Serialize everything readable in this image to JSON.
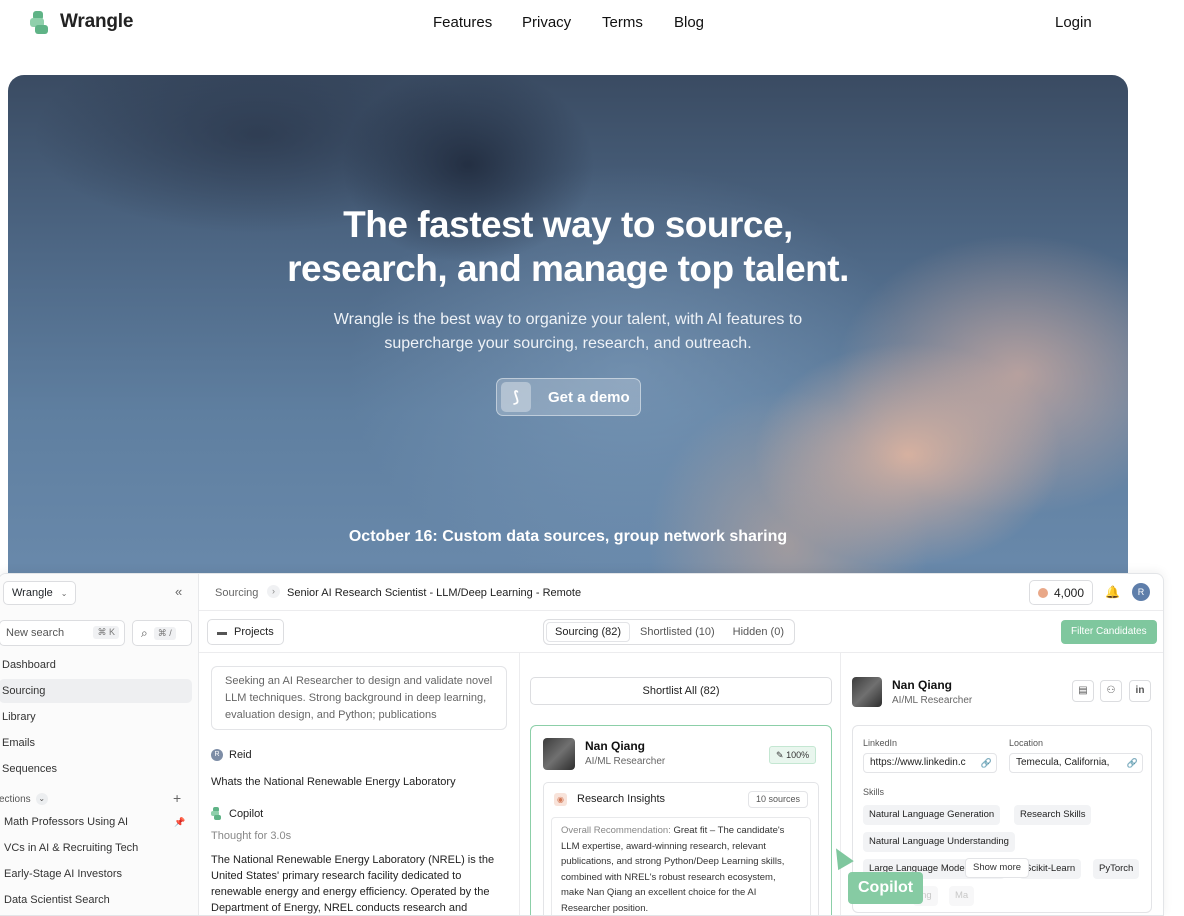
{
  "brand": {
    "name": "Wrangle",
    "accent": "#5fb386"
  },
  "nav": {
    "links": [
      "Features",
      "Privacy",
      "Terms",
      "Blog"
    ],
    "login": "Login"
  },
  "hero": {
    "title_line1": "The fastest way to source,",
    "title_line2": "research, and manage top talent.",
    "subtitle_line1": "Wrangle is the best way to organize your talent, with AI features to",
    "subtitle_line2": "supercharge your sourcing, research, and outreach.",
    "cta": "Get a demo",
    "news": "October 16: Custom data sources, group network sharing"
  },
  "app": {
    "workspace": "Wrangle",
    "search_placeholder": "New search",
    "search_shortcut": "⌘ K",
    "command_shortcut": "⌘ /",
    "sidebar_items": [
      "Dashboard",
      "Sourcing",
      "Library",
      "Emails",
      "Sequences"
    ],
    "active_item": "Sourcing",
    "collections_label": "ections",
    "collections": [
      "Math Professors Using AI",
      "VCs in AI & Recruiting Tech",
      "Early-Stage AI Investors",
      "Data Scientist Search"
    ],
    "breadcrumb": [
      "Sourcing",
      "Senior AI Research Scientist - LLM/Deep Learning - Remote"
    ],
    "credits": "4,000",
    "user_initial": "R",
    "projects_label": "Projects",
    "tabs": [
      "Sourcing (82)",
      "Shortlisted (10)",
      "Hidden (0)"
    ],
    "filter_button": "Filter Candidates",
    "query": "Seeking an AI Researcher to design and validate novel LLM techniques. Strong background in deep learning, evaluation design, and Python; publications",
    "chat": {
      "user_name": "Reid",
      "user_initial": "R",
      "user_message": "Whats the National Renewable Energy Laboratory",
      "bot_name": "Copilot",
      "thought": "Thought for 3.0s",
      "bot_message": "The National Renewable Energy Laboratory (NREL) is the United States' primary research facility dedicated to renewable energy and energy efficiency. Operated by the Department of Energy, NREL conducts research and"
    },
    "shortlist_all": "Shortlist All (82)",
    "candidate": {
      "name": "Nan Qiang",
      "role": "AI/ML Researcher",
      "match": "100%",
      "insights_title": "Research Insights",
      "insights_sources": "10 sources",
      "recommendation_label": "Overall Recommendation:",
      "recommendation": "Great fit – The candidate's LLM expertise, award-winning research, relevant publications, and strong Python/Deep Learning skills, combined with NREL's robust research ecosystem, make Nan Qiang an excellent choice for the AI Researcher position."
    },
    "detail": {
      "linkedin_label": "LinkedIn",
      "linkedin_value": "https://www.linkedin.c",
      "location_label": "Location",
      "location_value": "Temecula, California,",
      "skills_label": "Skills",
      "skills": [
        "Natural Language Generation",
        "Research Skills",
        "Natural Language Understanding",
        "Large Language Models (LLM)",
        "Scikit-Learn",
        "PyTorch"
      ],
      "faded_skills": [
        "ing",
        "Ma"
      ],
      "show_more": "Show more"
    },
    "copilot_tag": "Copilot"
  }
}
